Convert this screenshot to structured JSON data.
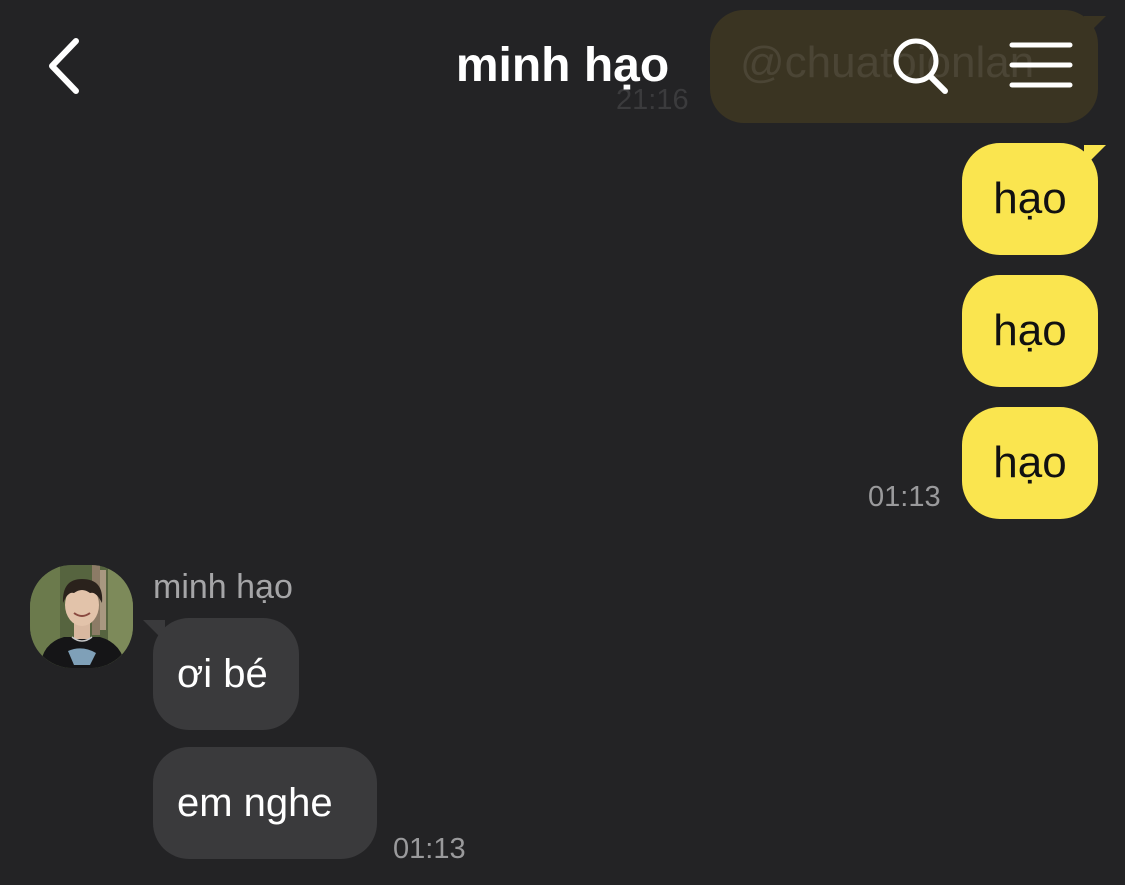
{
  "header": {
    "title": "minh hạo",
    "back_icon": "chevron-left-icon",
    "search_icon": "search-icon",
    "menu_icon": "hamburger-menu-icon"
  },
  "ghost_message": {
    "text": "@chuatoionlan",
    "time": "21:16"
  },
  "outgoing_messages": [
    {
      "text": "hạo"
    },
    {
      "text": "hạo"
    },
    {
      "text": "hạo"
    }
  ],
  "outgoing_time": "01:13",
  "incoming": {
    "sender": "minh hạo",
    "messages": [
      {
        "text": "ơi bé"
      },
      {
        "text": "em nghe"
      }
    ],
    "time": "01:13"
  },
  "colors": {
    "background": "#232325",
    "outgoing_bubble": "#fae54f",
    "incoming_bubble": "#3a3a3c",
    "timestamp": "#9a9a9c"
  }
}
